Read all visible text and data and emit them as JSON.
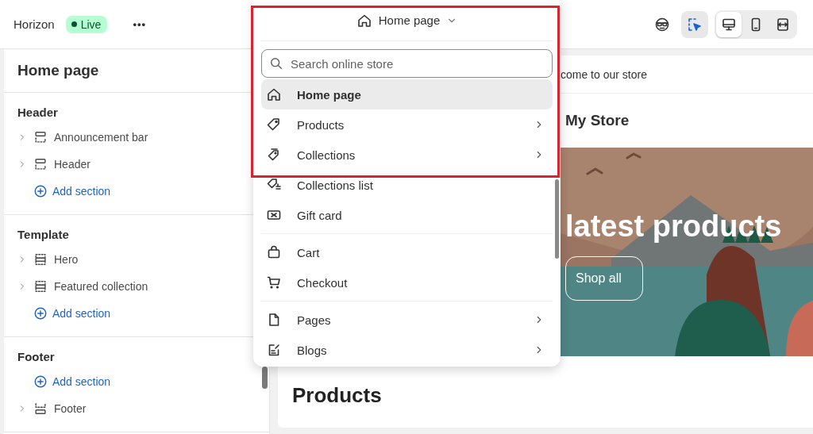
{
  "topbar": {
    "store_name": "Horizon",
    "status_badge": "Live",
    "more_button": "•••",
    "page_selector": "Home page",
    "inspector": {
      "on": true
    },
    "view_modes": [
      {
        "selected": true
      },
      {
        "selected": false
      },
      {
        "selected": false
      }
    ]
  },
  "sidebar": {
    "title": "Home page",
    "groups": [
      {
        "title": "Header",
        "items": [
          {
            "kind": "section",
            "label": "Announcement bar"
          },
          {
            "kind": "section",
            "label": "Header"
          },
          {
            "kind": "add",
            "label": "Add section"
          }
        ]
      },
      {
        "title": "Template",
        "items": [
          {
            "kind": "section",
            "label": "Hero"
          },
          {
            "kind": "section",
            "label": "Featured collection"
          },
          {
            "kind": "add",
            "label": "Add section"
          }
        ]
      },
      {
        "title": "Footer",
        "items": [
          {
            "kind": "add",
            "label": "Add section"
          },
          {
            "kind": "section",
            "label": "Footer"
          }
        ]
      }
    ]
  },
  "page_menu": {
    "search": {
      "placeholder": "Search online store"
    },
    "groups": [
      [
        {
          "label": "Home page",
          "selected": true,
          "has_submenu": false
        },
        {
          "label": "Products",
          "selected": false,
          "has_submenu": true
        },
        {
          "label": "Collections",
          "selected": false,
          "has_submenu": true
        },
        {
          "label": "Collections list",
          "selected": false,
          "has_submenu": false
        },
        {
          "label": "Gift card",
          "selected": false,
          "has_submenu": false
        }
      ],
      [
        {
          "label": "Cart",
          "selected": false,
          "has_submenu": false
        },
        {
          "label": "Checkout",
          "selected": false,
          "has_submenu": false
        }
      ],
      [
        {
          "label": "Pages",
          "selected": false,
          "has_submenu": true
        },
        {
          "label": "Blogs",
          "selected": false,
          "has_submenu": true
        }
      ]
    ]
  },
  "preview": {
    "announcement": "come to our store",
    "store_name": "My Store",
    "hero": {
      "heading": "latest products",
      "button": "Shop all"
    },
    "section_heading": "Products"
  }
}
